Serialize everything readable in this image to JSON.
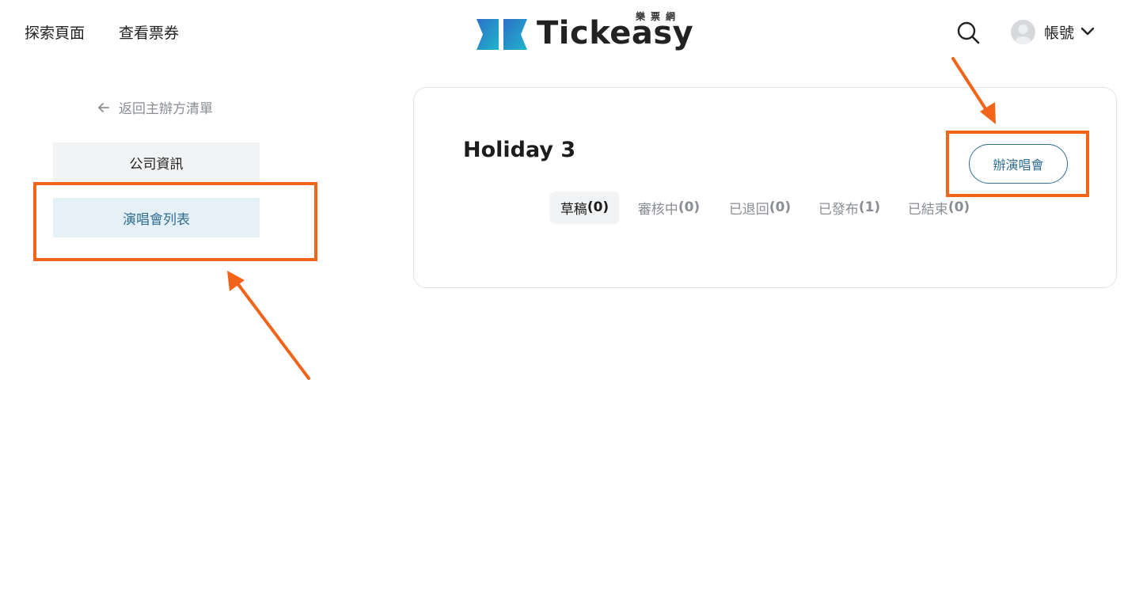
{
  "topnav": {
    "explore": "探索頁面",
    "tickets": "查看票券",
    "logo_text": "Tickeasy",
    "logo_sub": "樂票網",
    "account_label": "帳號"
  },
  "sidebar": {
    "back_label": "返回主辦方清單",
    "items": [
      {
        "label": "公司資訊",
        "active": false
      },
      {
        "label": "演唱會列表",
        "active": true
      }
    ]
  },
  "main": {
    "title": "Holiday 3",
    "create_button": "辦演唱會",
    "tabs": [
      {
        "label": "草稿",
        "count": "(0)",
        "active": true
      },
      {
        "label": "審核中",
        "count": "(0)",
        "active": false
      },
      {
        "label": "已退回",
        "count": "(0)",
        "active": false
      },
      {
        "label": "已發布",
        "count": "(1)",
        "active": false
      },
      {
        "label": "已結束",
        "count": "(0)",
        "active": false
      }
    ]
  },
  "icons": {
    "search": "search-icon",
    "avatar": "user-avatar-icon",
    "dropdown": "chevron-down-icon",
    "back": "arrow-left-icon"
  },
  "colors": {
    "accent": "#2f6d94",
    "annotation": "#f1641a",
    "active_sidebar_bg": "#e6f0f7"
  }
}
